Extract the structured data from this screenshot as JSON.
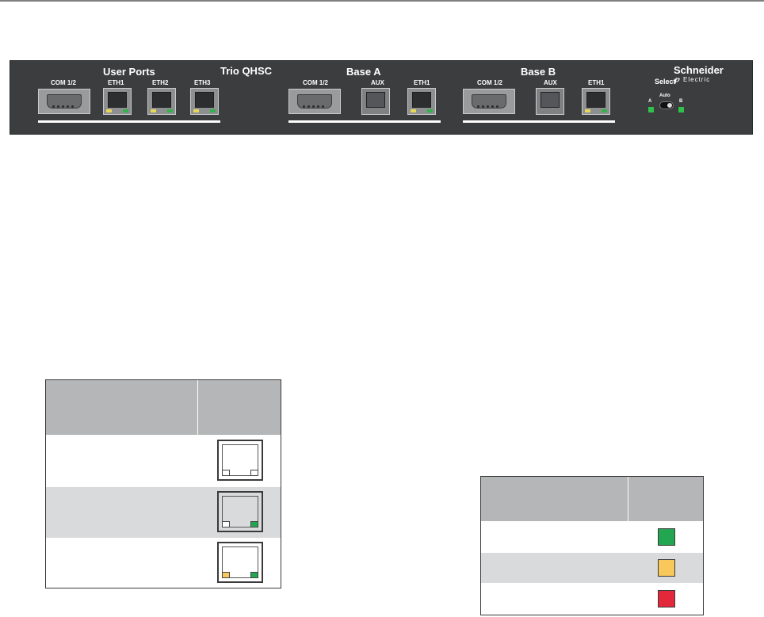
{
  "panel": {
    "model": "Trio QHSC",
    "brand": {
      "name": "Schneider",
      "sub": "Electric"
    },
    "groups": {
      "user_ports": {
        "title": "User Ports",
        "ports": [
          "COM 1/2",
          "ETH1",
          "ETH2",
          "ETH3"
        ]
      },
      "base_a": {
        "title": "Base A",
        "ports": [
          "COM 1/2",
          "AUX",
          "ETH1"
        ]
      },
      "base_b": {
        "title": "Base B",
        "ports": [
          "COM 1/2",
          "AUX",
          "ETH1"
        ]
      }
    },
    "select": {
      "title": "Select",
      "mode": "Auto",
      "a": "A",
      "b": "B"
    },
    "colors": {
      "body": "#3c3d3f",
      "led_green": "#34b14a",
      "led_yellow": "#e6d65a"
    }
  },
  "ethernet_legend": {
    "header": [
      "",
      ""
    ],
    "rows": [
      {
        "desc": "",
        "left_led": "off",
        "right_led": "off",
        "shaded": false
      },
      {
        "desc": "",
        "left_led": "off",
        "right_led": "green",
        "shaded": true
      },
      {
        "desc": "",
        "left_led": "yellow",
        "right_led": "green",
        "shaded": false
      }
    ]
  },
  "led_legend": {
    "header": [
      "",
      ""
    ],
    "rows": [
      {
        "desc": "",
        "color": "#22a650",
        "shaded": false
      },
      {
        "desc": "",
        "color": "#f8c95a",
        "shaded": true
      },
      {
        "desc": "",
        "color": "#e3283c",
        "shaded": false
      }
    ]
  }
}
